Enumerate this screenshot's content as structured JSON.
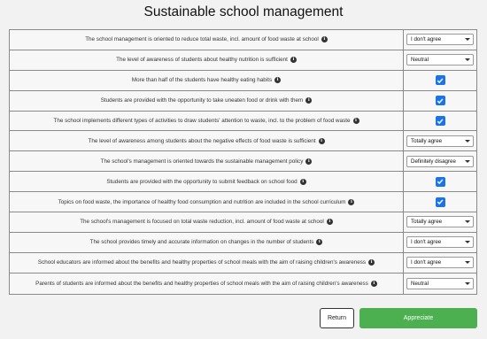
{
  "page": {
    "title": "Sustainable school management"
  },
  "rows": [
    {
      "question": "The school management is oriented to reduce total waste, incl. amount of food waste at school",
      "type": "select",
      "value": "I don't agree"
    },
    {
      "question": "The level of awareness of students about healthy nutrition is sufficient",
      "type": "select",
      "value": "Neutral"
    },
    {
      "question": "More than half of the students have healthy eating habits",
      "type": "checkbox",
      "checked": true
    },
    {
      "question": "Students are provided with the opportunity to take uneaten food or drink with them",
      "type": "checkbox",
      "checked": true
    },
    {
      "question": "The school implements different types of activities to draw students' attention to waste, incl. to the problem of food waste",
      "type": "checkbox",
      "checked": true
    },
    {
      "question": "The level of awareness among students about the negative effects of food waste is sufficient",
      "type": "select",
      "value": "Totally agree"
    },
    {
      "question": "The school's management is oriented towards the sustainable management policy",
      "type": "select",
      "value": "Definitely disagree"
    },
    {
      "question": "Students are provided with the opportunity to submit feedback on school food",
      "type": "checkbox",
      "checked": true
    },
    {
      "question": "Topics on food waste, the importance of healthy food consumption and nutrition are included in the school curriculum",
      "type": "checkbox",
      "checked": true
    },
    {
      "question": "The school's management is focused on total waste reduction, incl. amount of food waste at school",
      "type": "select",
      "value": "Totally agree"
    },
    {
      "question": "The school provides timely and accurate information on changes in the number of students",
      "type": "select",
      "value": "I don't agree"
    },
    {
      "question": "School educators are informed about the benefits and healthy properties of school meals with the aim of raising children's awareness",
      "type": "select",
      "value": "I don't agree"
    },
    {
      "question": "Parents of students are informed about the benefits and healthy properties of school meals with the aim of raising children's awareness",
      "type": "select",
      "value": "Neutral"
    }
  ],
  "info_icon": "info-icon",
  "buttons": {
    "return_label": "Return",
    "appreciate_label": "Appreciate"
  },
  "colors": {
    "checkbox": "#1a73e8",
    "appreciate": "#4caf50"
  }
}
